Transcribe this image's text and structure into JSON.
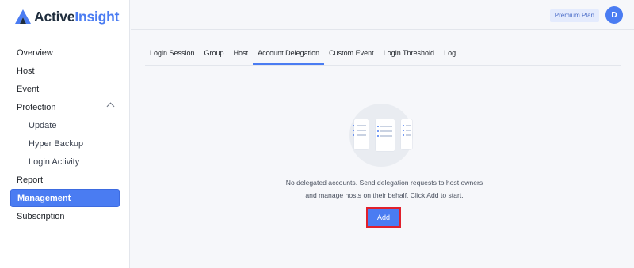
{
  "brand": {
    "name_part1": "Active",
    "name_part2": "Insight",
    "accent": "#4a7cf2"
  },
  "header": {
    "plan_label": "Premium Plan",
    "avatar_initial": "D"
  },
  "sidebar": {
    "items": [
      {
        "label": "Overview"
      },
      {
        "label": "Host"
      },
      {
        "label": "Event"
      },
      {
        "label": "Protection"
      },
      {
        "label": "Update"
      },
      {
        "label": "Hyper Backup"
      },
      {
        "label": "Login Activity"
      },
      {
        "label": "Report"
      },
      {
        "label": "Management",
        "active": true
      },
      {
        "label": "Subscription"
      }
    ]
  },
  "tabs": [
    {
      "label": "Login Session"
    },
    {
      "label": "Group"
    },
    {
      "label": "Host"
    },
    {
      "label": "Account Delegation",
      "active": true
    },
    {
      "label": "Custom Event"
    },
    {
      "label": "Login Threshold"
    },
    {
      "label": "Log"
    }
  ],
  "empty_state": {
    "line1": "No delegated accounts. Send delegation requests to host owners",
    "line2": "and manage hosts on their behalf. Click Add to start.",
    "add_label": "Add"
  }
}
